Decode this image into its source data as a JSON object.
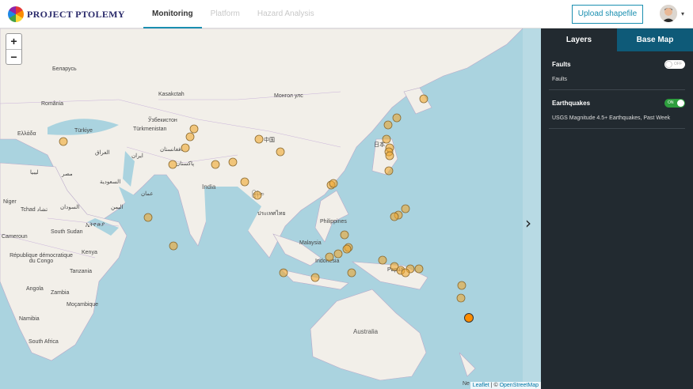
{
  "app": {
    "logo_text": "PROJECT PTOLEMY"
  },
  "nav": {
    "tabs": [
      {
        "label": "Monitoring"
      },
      {
        "label": "Platform"
      },
      {
        "label": "Hazard Analysis"
      }
    ]
  },
  "header": {
    "upload_label": "Upload shapefile",
    "caret": "▾"
  },
  "map": {
    "zoom_in": "+",
    "zoom_out": "−",
    "next_arrow": "›",
    "attribution": {
      "leaflet": "Leaflet",
      "sep": " | © ",
      "osm": "OpenStreetMap"
    },
    "labels": [
      "Беларусь",
      "Kasakctah",
      "Монгол улс",
      "România",
      "Ўзбекистон",
      "Ελλάδα",
      "Türkiye",
      "Türkmenistan",
      "中国",
      "日本",
      "افغانستان",
      "العراق",
      "ایران",
      "پاکستان",
      "India",
      "مصر",
      "ليبيا",
      "السعودية",
      "عمان",
      "မြန်မာ",
      "ประเทศไทย",
      "Philippines",
      "Malaysia",
      "Indonesia",
      "Niger",
      "Tchad تشاد",
      "السودان",
      "اليمن",
      "ኢትዮጵያ",
      "South Sudan",
      "Cameroun",
      "Kenya",
      "République démocratique du Congo",
      "Tanzania",
      "Angola",
      "Zambia",
      "Moçambique",
      "Namibia",
      "South Africa",
      "Australia",
      "Papua",
      "Ne"
    ],
    "marker_color": "#f0a830",
    "highlight_color": "#ff8c00"
  },
  "panel": {
    "tabs": [
      {
        "label": "Layers"
      },
      {
        "label": "Base Map"
      }
    ],
    "layers": [
      {
        "title": "Faults",
        "description": "Faults",
        "toggle": "OFF"
      },
      {
        "title": "Earthquakes",
        "description": "USGS Magnitude 4.5+ Earthquakes, Past Week",
        "toggle": "ON"
      }
    ]
  }
}
